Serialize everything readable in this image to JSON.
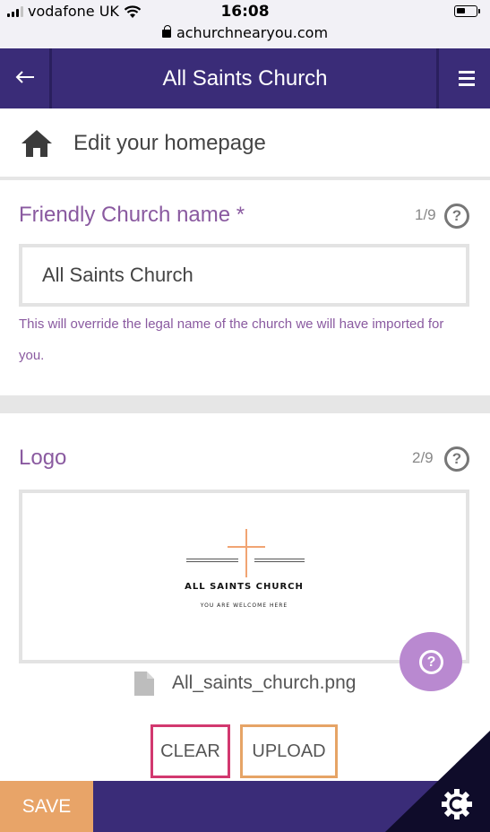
{
  "status_bar": {
    "carrier": "vodafone UK",
    "time": "16:08",
    "url": "achurchnearyou.com"
  },
  "header": {
    "back_icon": "arrow-left-icon",
    "title": "All Saints Church",
    "menu_icon": "hamburger-icon"
  },
  "page": {
    "title": "Edit your homepage",
    "icon": "home-icon"
  },
  "friendly_name": {
    "label": "Friendly Church name *",
    "step": "1/9",
    "help_glyph": "?",
    "value": "All Saints Church",
    "hint": "This will override the legal name of the church we will have imported for you."
  },
  "logo": {
    "label": "Logo",
    "step": "2/9",
    "help_glyph": "?",
    "preview": {
      "church_name": "ALL SAINTS CHURCH",
      "tagline": "YOU ARE WELCOME HERE"
    },
    "file_name": "All_saints_church.png",
    "clear_label": "CLEAR",
    "upload_label": "UPLOAD"
  },
  "floating_help": {
    "glyph": "?"
  },
  "footer": {
    "save_label": "SAVE",
    "corner_icon": "cog-icon"
  },
  "colors": {
    "header_bg": "#3a2c78",
    "label_purple": "#8a5aa0",
    "save_orange": "#e8a468",
    "clear_border": "#d2386f",
    "upload_border": "#e6a466",
    "fab": "#b989d0"
  }
}
